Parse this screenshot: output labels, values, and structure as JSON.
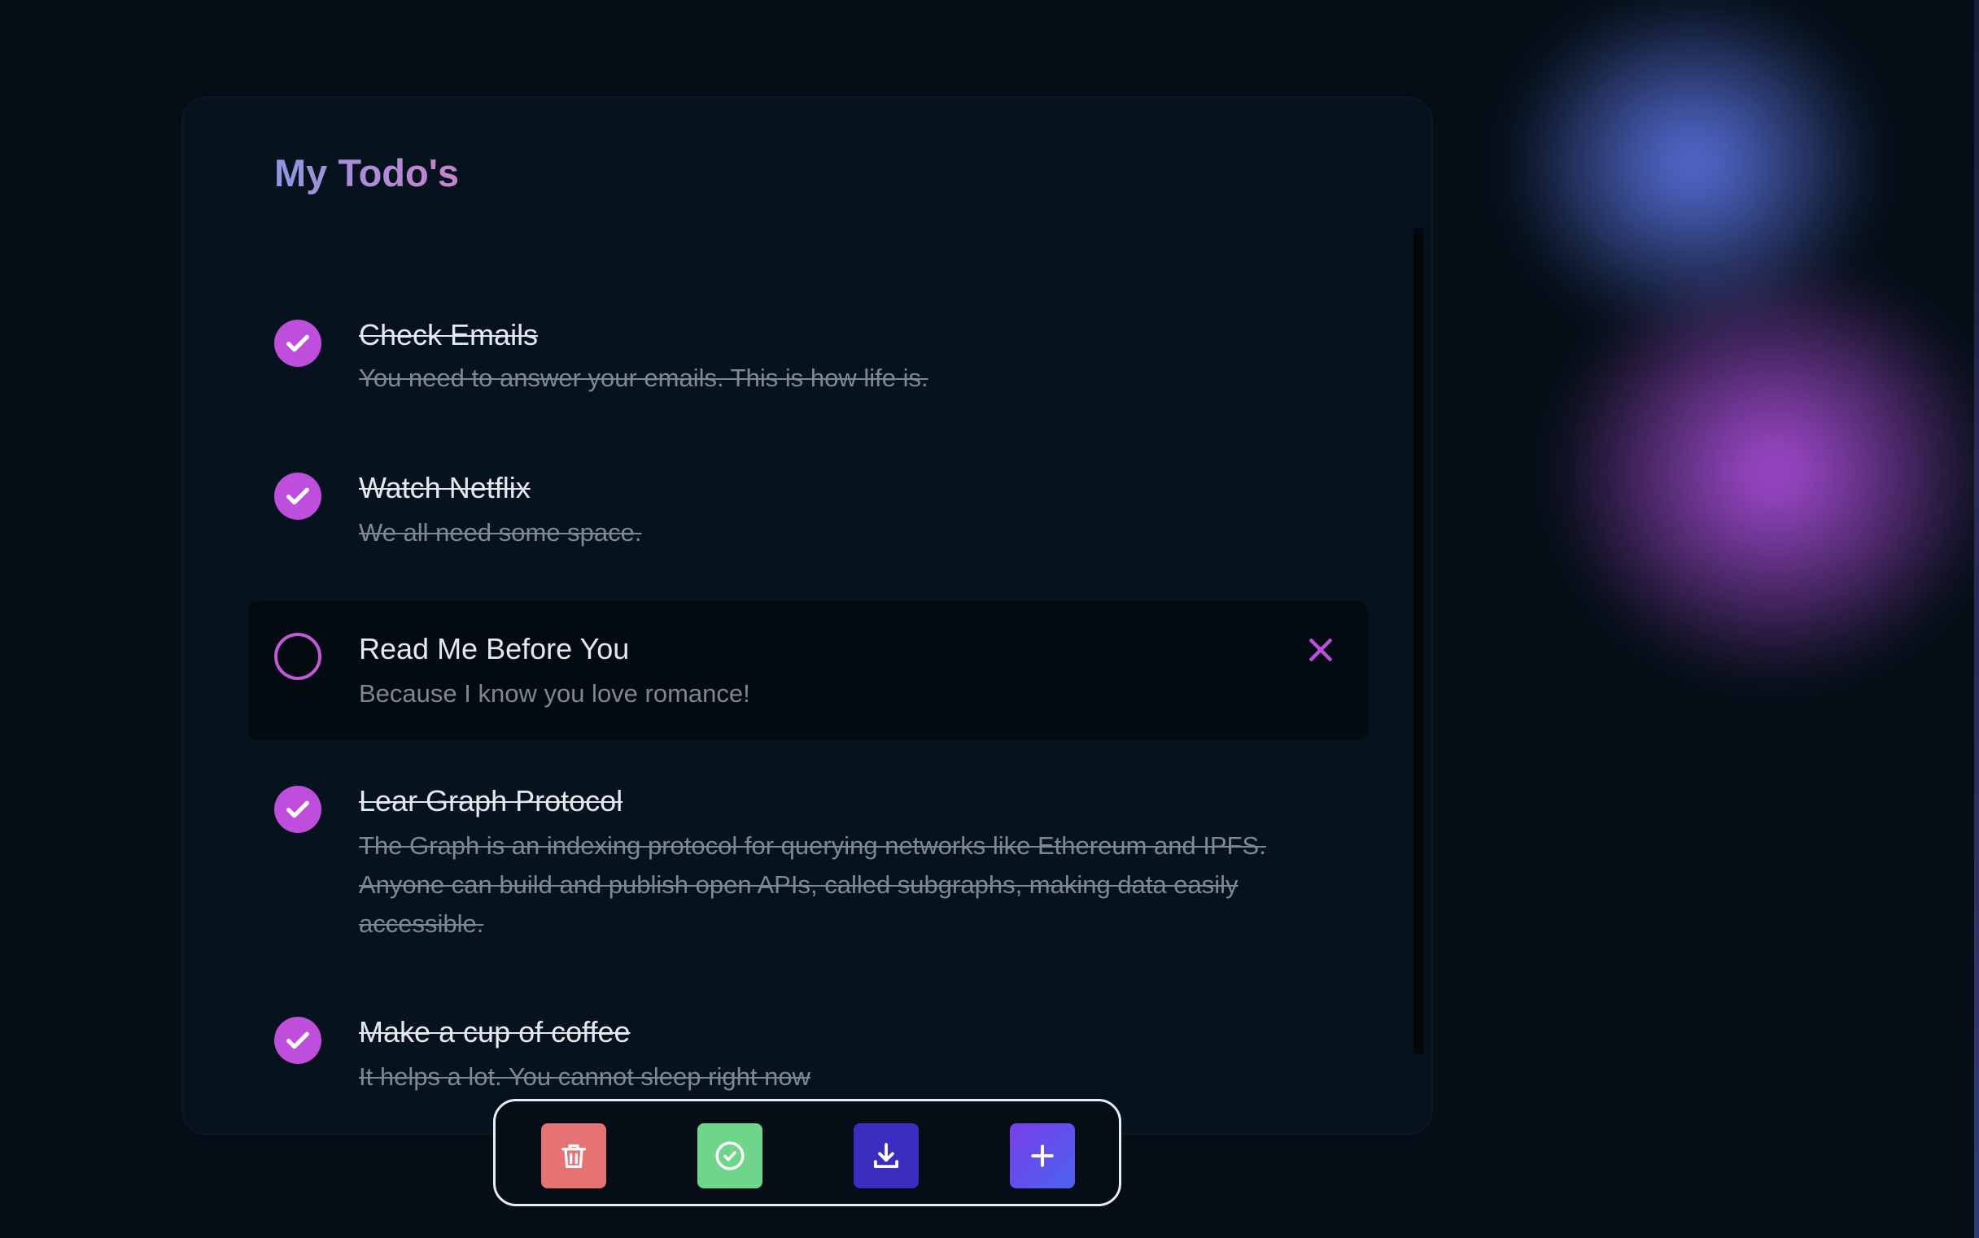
{
  "page": {
    "title": "My Todo's"
  },
  "todos": [
    {
      "title": "Check Emails",
      "description": "You need to answer your emails. This is how life is.",
      "completed": true
    },
    {
      "title": "Watch Netflix",
      "description": "We all need some space.",
      "completed": true
    },
    {
      "title": "Read Me Before You",
      "description": "Because I know you love romance!",
      "completed": false
    },
    {
      "title": "Lear Graph Protocol",
      "description": "The Graph is an indexing protocol for querying networks like Ethereum and IPFS. Anyone can build and publish open APIs, called subgraphs, making data easily accessible.",
      "completed": true
    },
    {
      "title": "Make a cup of coffee",
      "description": "It helps a lot. You cannot sleep right now",
      "completed": true
    }
  ],
  "toolbar": {
    "buttons": [
      {
        "action": "delete",
        "icon": "trash-icon",
        "color": "#e57373"
      },
      {
        "action": "complete",
        "icon": "check-circle-icon",
        "color": "#6fd58b"
      },
      {
        "action": "download",
        "icon": "download-icon",
        "color": "#3b2dbf"
      },
      {
        "action": "add",
        "icon": "plus-icon",
        "color": "#6b4ee8"
      }
    ]
  },
  "colors": {
    "accent": "#c04edc",
    "background": "#050e16",
    "card": "#06131e"
  }
}
